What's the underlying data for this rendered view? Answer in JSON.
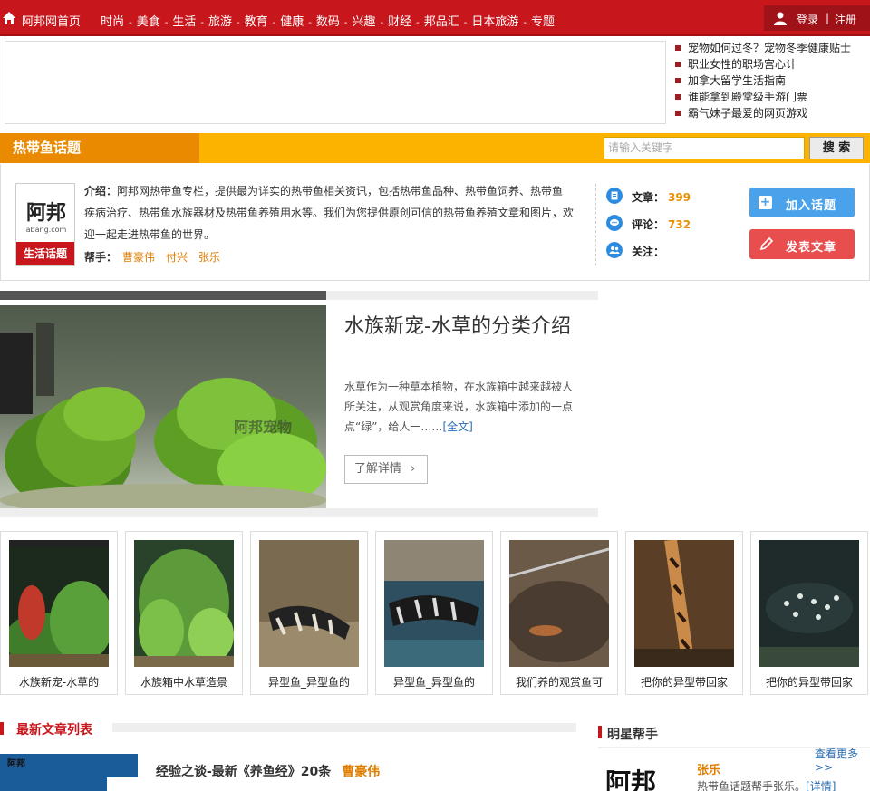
{
  "nav": {
    "home": "阿邦网首页",
    "items": [
      "时尚",
      "美食",
      "生活",
      "旅游",
      "教育",
      "健康",
      "数码",
      "兴趣",
      "财经",
      "邦品汇",
      "日本旅游",
      "专题"
    ],
    "login": "登录",
    "divider": "|",
    "register": "注册"
  },
  "headlines": [
    "宠物如何过冬？宠物冬季健康贴士",
    "职业女性的职场宫心计",
    "加拿大留学生活指南",
    "谁能拿到殿堂级手游门票",
    "霸气妹子最爱的网页游戏"
  ],
  "topic": {
    "title": "热带鱼话题",
    "search_placeholder": "请输入关键字",
    "search_button": "搜 索"
  },
  "intro": {
    "logo_mark": "阿邦",
    "logo_domain": "abang.com",
    "logo_band": "生活话题",
    "desc_label": "介绍：",
    "desc_text": "阿邦网热带鱼专栏，提供最为详实的热带鱼相关资讯，包括热带鱼品种、热带鱼饲养、热带鱼疾病治疗、热带鱼水族器材及热带鱼养殖用水等。我们为您提供原创可信的热带鱼养殖文章和图片，欢迎一起走进热带鱼的世界。",
    "helpers_label": "帮手：",
    "helpers": [
      "曹豪伟",
      "付兴",
      "张乐"
    ],
    "stats": {
      "articles_label": "文章：",
      "articles": "399",
      "comments_label": "评论：",
      "comments": "732",
      "follow_label": "关注："
    },
    "join_button": "加入话题",
    "post_button": "发表文章"
  },
  "feature": {
    "title": "水族新宠-水草的分类介绍",
    "summary": "水草作为一种草本植物，在水族箱中越来越被人所关注，从观赏角度来说，水族箱中添加的一点点“绿”，给人一……",
    "more": "[全文]",
    "button": "了解详情",
    "watermark": "阿邦宠物"
  },
  "thumbs": [
    {
      "caption": "水族新宠-水草的"
    },
    {
      "caption": "水族箱中水草造景"
    },
    {
      "caption": "异型鱼_异型鱼的"
    },
    {
      "caption": "异型鱼_异型鱼的"
    },
    {
      "caption": "我们养的观赏鱼可"
    },
    {
      "caption": "把你的异型带回家"
    },
    {
      "caption": "把你的异型带回家"
    }
  ],
  "latest": {
    "title": "最新文章列表",
    "first_title": "经验之谈-最新《养鱼经》20条",
    "first_author": "曹豪伟"
  },
  "star": {
    "title": "明星帮手",
    "more": "查看更多>>",
    "logo": "阿邦",
    "name": "张乐",
    "desc": "热带鱼话题帮手张乐。",
    "detail": "[详情]"
  },
  "colors": {
    "brand_red": "#c8161d",
    "topic_yellow": "#fbb300",
    "topic_orange": "#ea8a00",
    "accent_orange": "#e07d00",
    "link_blue": "#2a6bb0",
    "join_blue": "#49a2ea",
    "post_red": "#e94e4e"
  }
}
